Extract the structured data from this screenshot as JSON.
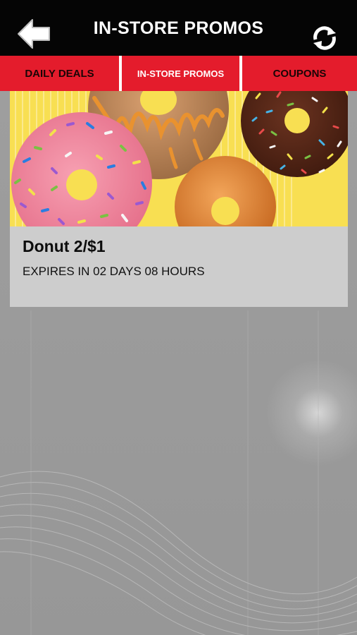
{
  "header": {
    "title": "IN-STORE PROMOS",
    "back_icon": "back-arrow-icon",
    "refresh_icon": "refresh-icon"
  },
  "tabs": [
    {
      "label": "DAILY DEALS",
      "active": false
    },
    {
      "label": "IN-STORE PROMOS",
      "active": true
    },
    {
      "label": "COUPONS",
      "active": false
    }
  ],
  "promos": [
    {
      "title": "Donut 2/$1",
      "expiry": "EXPIRES IN 02 DAYS 08 HOURS"
    }
  ],
  "colors": {
    "header_bg": "#050505",
    "tab_bar": "#e41c2c",
    "active_tab_text": "#ffffff",
    "inactive_tab_text": "#1a0506",
    "card_bg": "#cdcdcd",
    "page_bg": "#9c9c9c"
  }
}
